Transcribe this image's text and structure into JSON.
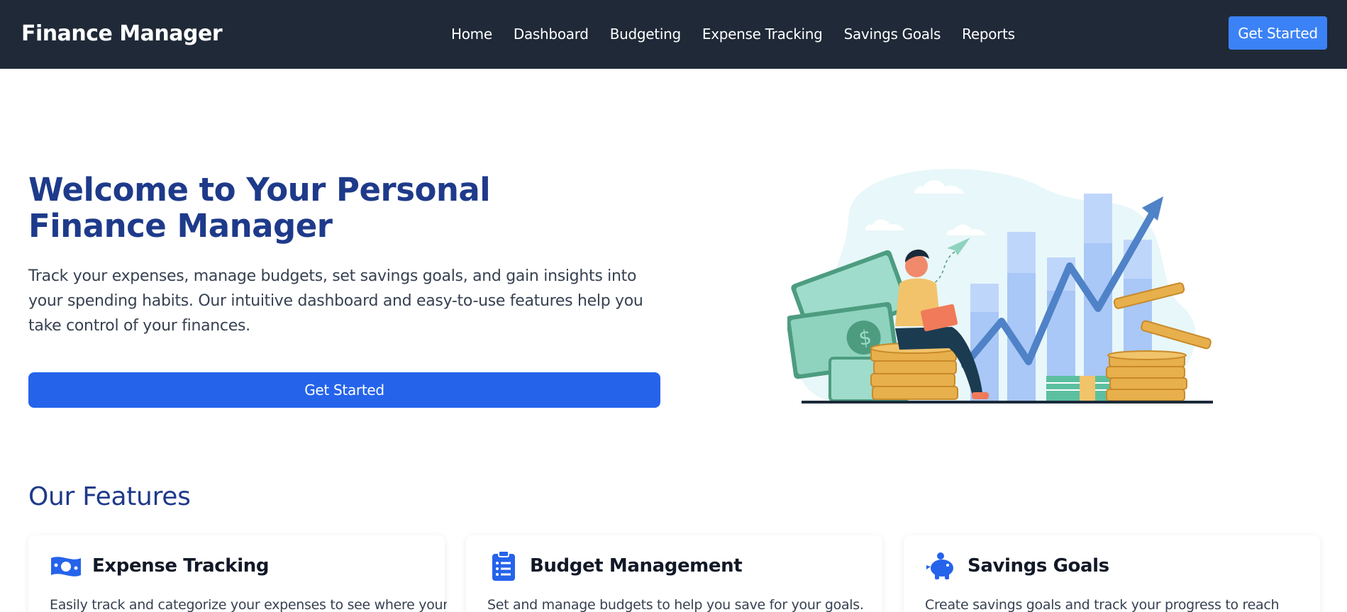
{
  "header": {
    "brand": "Finance Manager",
    "nav": [
      "Home",
      "Dashboard",
      "Budgeting",
      "Expense Tracking",
      "Savings Goals",
      "Reports"
    ],
    "cta_label": "Get Started"
  },
  "hero": {
    "title": "Welcome to Your Personal Finance Manager",
    "description": "Track your expenses, manage budgets, set savings goals, and gain insights into your spending habits. Our intuitive dashboard and easy-to-use features help you take control of your finances.",
    "cta_label": "Get Started"
  },
  "features": {
    "title": "Our Features",
    "cards": [
      {
        "title": "Expense Tracking",
        "description": "Easily track and categorize your expenses to see where your",
        "icon": "money-bill-icon"
      },
      {
        "title": "Budget Management",
        "description": "Set and manage budgets to help you save for your goals.",
        "icon": "clipboard-list-icon"
      },
      {
        "title": "Savings Goals",
        "description": "Create savings goals and track your progress to reach",
        "icon": "piggy-bank-icon"
      }
    ]
  },
  "colors": {
    "header_bg": "#1f2937",
    "accent": "#3b82f6",
    "primary_button": "#2563eb",
    "heading": "#1e3a8a"
  }
}
